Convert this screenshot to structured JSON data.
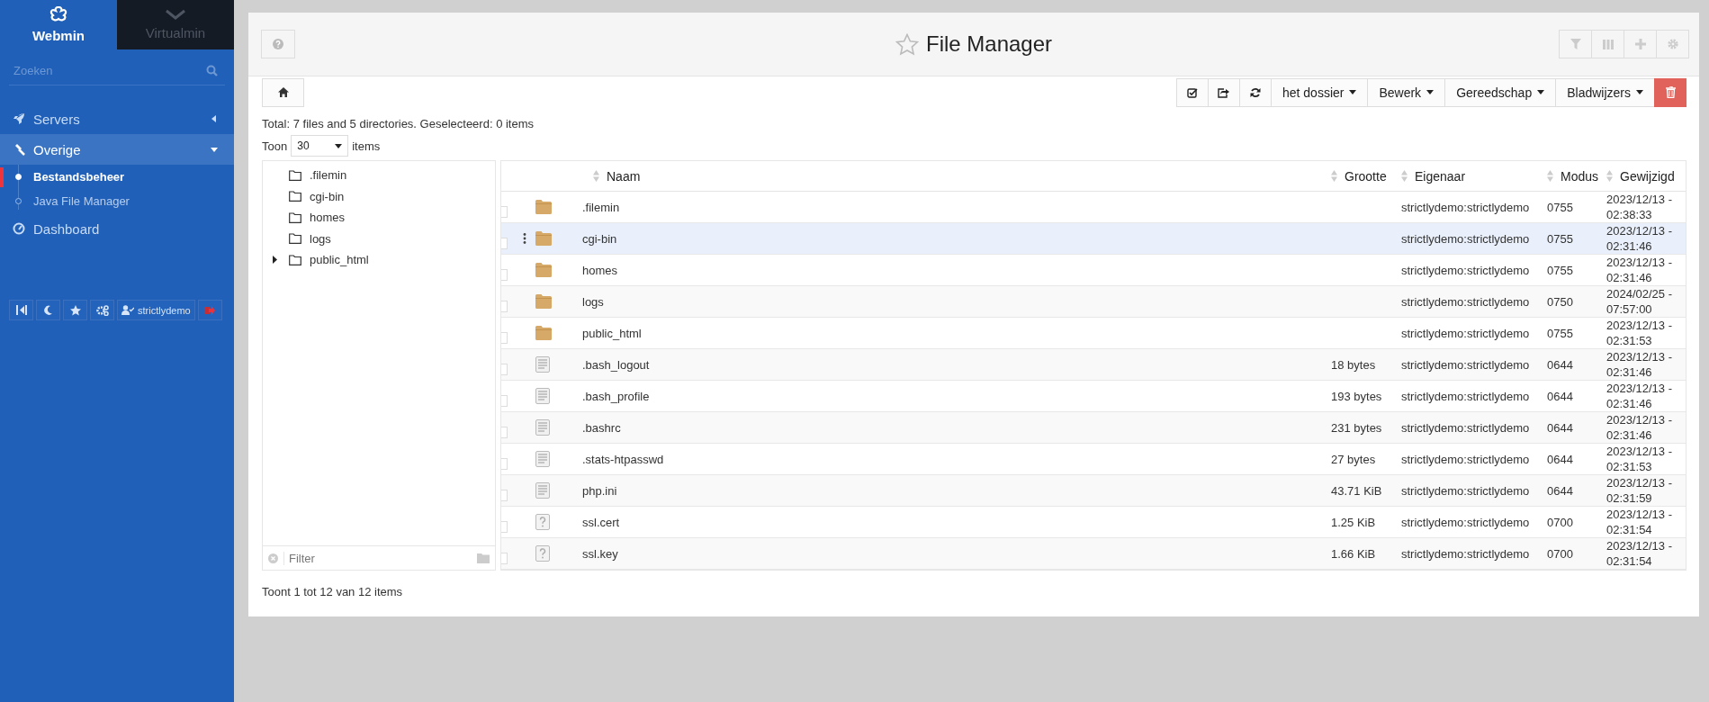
{
  "sidebar": {
    "tabs": [
      {
        "label": "Webmin",
        "selected": true
      },
      {
        "label": "Virtualmin",
        "selected": false
      }
    ],
    "search": {
      "placeholder": "Zoeken"
    },
    "menu": [
      {
        "label": "Servers",
        "kind": "group",
        "expanded": false
      },
      {
        "label": "Overige",
        "kind": "group",
        "expanded": true,
        "children": [
          {
            "label": "Bestandsbeheer",
            "selected": true
          },
          {
            "label": "Java File Manager",
            "selected": false
          }
        ]
      },
      {
        "label": "Dashboard",
        "kind": "link"
      }
    ],
    "user": "strictlydemo"
  },
  "page": {
    "title": "File Manager",
    "menus": [
      "het dossier",
      "Bewerk",
      "Gereedschap",
      "Bladwijzers"
    ],
    "summary": "Total: 7 files and 5 directories. Geselecteerd: 0 items",
    "show": {
      "before": "Toon",
      "value": "30",
      "after": "items"
    },
    "tree": [
      {
        "name": ".filemin",
        "expandable": false
      },
      {
        "name": "cgi-bin",
        "expandable": false
      },
      {
        "name": "homes",
        "expandable": false
      },
      {
        "name": "logs",
        "expandable": false
      },
      {
        "name": "public_html",
        "expandable": true
      }
    ],
    "tree_filter": {
      "placeholder": "Filter"
    },
    "table": {
      "columns": [
        "Naam",
        "Grootte",
        "Eigenaar",
        "Modus",
        "Gewijzigd"
      ],
      "rows": [
        {
          "kind": "folder",
          "name": ".filemin",
          "owner": "strictlydemo:strictlydemo",
          "mode": "0755",
          "modified": "2023/12/13 - 02:38:33",
          "highlighted": false
        },
        {
          "kind": "folder",
          "name": "cgi-bin",
          "owner": "strictlydemo:strictlydemo",
          "mode": "0755",
          "modified": "2023/12/13 - 02:31:46",
          "highlighted": true
        },
        {
          "kind": "folder",
          "name": "homes",
          "owner": "strictlydemo:strictlydemo",
          "mode": "0755",
          "modified": "2023/12/13 - 02:31:46",
          "highlighted": false
        },
        {
          "kind": "folder",
          "name": "logs",
          "owner": "strictlydemo:strictlydemo",
          "mode": "0750",
          "modified": "2024/02/25 - 07:57:00",
          "highlighted": false
        },
        {
          "kind": "folder",
          "name": "public_html",
          "owner": "strictlydemo:strictlydemo",
          "mode": "0755",
          "modified": "2023/12/13 - 02:31:53",
          "highlighted": false
        },
        {
          "kind": "text",
          "name": ".bash_logout",
          "size": "18 bytes",
          "owner": "strictlydemo:strictlydemo",
          "mode": "0644",
          "modified": "2023/12/13 - 02:31:46",
          "highlighted": false
        },
        {
          "kind": "text",
          "name": ".bash_profile",
          "size": "193 bytes",
          "owner": "strictlydemo:strictlydemo",
          "mode": "0644",
          "modified": "2023/12/13 - 02:31:46",
          "highlighted": false
        },
        {
          "kind": "text",
          "name": ".bashrc",
          "size": "231 bytes",
          "owner": "strictlydemo:strictlydemo",
          "mode": "0644",
          "modified": "2023/12/13 - 02:31:46",
          "highlighted": false
        },
        {
          "kind": "text",
          "name": ".stats-htpasswd",
          "size": "27 bytes",
          "owner": "strictlydemo:strictlydemo",
          "mode": "0644",
          "modified": "2023/12/13 - 02:31:53",
          "highlighted": false
        },
        {
          "kind": "text",
          "name": "php.ini",
          "size": "43.71 KiB",
          "owner": "strictlydemo:strictlydemo",
          "mode": "0644",
          "modified": "2023/12/13 - 02:31:59",
          "highlighted": false
        },
        {
          "kind": "unknown",
          "name": "ssl.cert",
          "size": "1.25 KiB",
          "owner": "strictlydemo:strictlydemo",
          "mode": "0700",
          "modified": "2023/12/13 - 02:31:54",
          "highlighted": false
        },
        {
          "kind": "unknown",
          "name": "ssl.key",
          "size": "1.66 KiB",
          "owner": "strictlydemo:strictlydemo",
          "mode": "0700",
          "modified": "2023/12/13 - 02:31:54",
          "highlighted": false
        }
      ]
    },
    "footer": "Toont 1 tot 12 van 12 items"
  }
}
